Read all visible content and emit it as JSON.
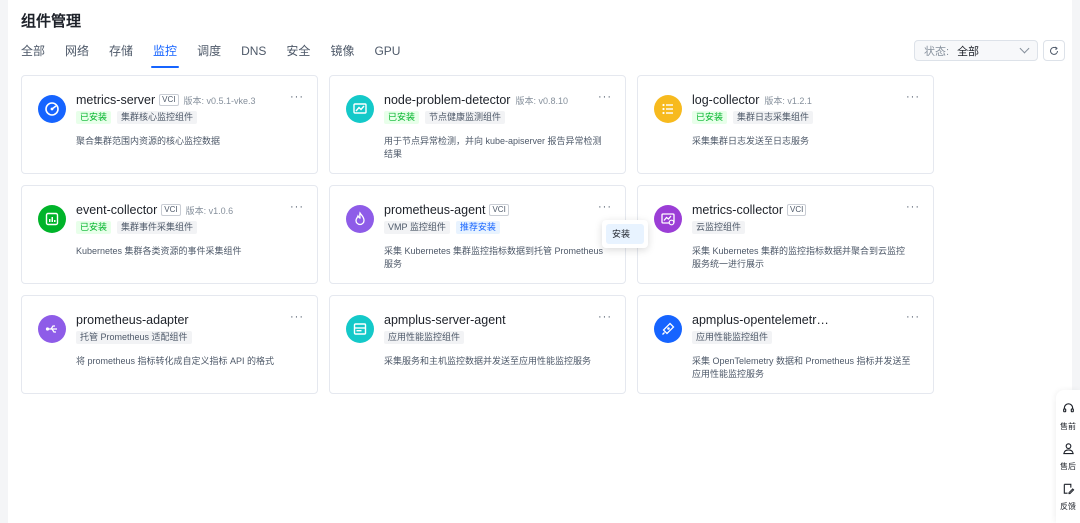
{
  "page_title": "组件管理",
  "tabs": [
    {
      "label": "全部",
      "active": false
    },
    {
      "label": "网络",
      "active": false
    },
    {
      "label": "存储",
      "active": false
    },
    {
      "label": "监控",
      "active": true
    },
    {
      "label": "调度",
      "active": false
    },
    {
      "label": "DNS",
      "active": false
    },
    {
      "label": "安全",
      "active": false
    },
    {
      "label": "镜像",
      "active": false
    },
    {
      "label": "GPU",
      "active": false
    }
  ],
  "filter": {
    "label": "状态:",
    "value": "全部"
  },
  "colors": {
    "accent": "#1664ff",
    "installed": "#00b42a"
  },
  "cards": [
    {
      "name": "metrics-server",
      "vci": "VCI",
      "version": "版本: v0.5.1-vke.3",
      "tags": [
        {
          "text": "已安装",
          "style": "green"
        },
        {
          "text": "集群核心监控组件",
          "style": "gray"
        }
      ],
      "desc": "聚合集群范围内资源的核心监控数据",
      "icon": "metrics-server-icon",
      "icon_color": "#1664ff"
    },
    {
      "name": "node-problem-detector",
      "vci": "",
      "version": "版本: v0.8.10",
      "tags": [
        {
          "text": "已安装",
          "style": "green"
        },
        {
          "text": "节点健康监测组件",
          "style": "gray"
        }
      ],
      "desc": "用于节点异常检测，并向 kube-apiserver 报告异常检测结果",
      "icon": "node-problem-detector-icon",
      "icon_color": "#14c9c9"
    },
    {
      "name": "log-collector",
      "vci": "",
      "version": "版本: v1.2.1",
      "tags": [
        {
          "text": "已安装",
          "style": "green"
        },
        {
          "text": "集群日志采集组件",
          "style": "gray"
        }
      ],
      "desc": "采集集群日志发送至日志服务",
      "icon": "log-collector-icon",
      "icon_color": "#f7ba1e"
    },
    {
      "name": "event-collector",
      "vci": "VCI",
      "version": "版本: v1.0.6",
      "tags": [
        {
          "text": "已安装",
          "style": "green"
        },
        {
          "text": "集群事件采集组件",
          "style": "gray"
        }
      ],
      "desc": "Kubernetes 集群各类资源的事件采集组件",
      "icon": "event-collector-icon",
      "icon_color": "#00b42a"
    },
    {
      "name": "prometheus-agent",
      "vci": "VCI",
      "version": "",
      "tags": [
        {
          "text": "VMP 监控组件",
          "style": "gray"
        },
        {
          "text": "推荐安装",
          "style": "blue"
        }
      ],
      "desc": "采集 Kubernetes 集群监控指标数据到托管 Prometheus 服务",
      "icon": "prometheus-agent-icon",
      "icon_color": "#8e5ce8"
    },
    {
      "name": "metrics-collector",
      "vci": "VCI",
      "version": "",
      "tags": [
        {
          "text": "云监控组件",
          "style": "gray"
        }
      ],
      "desc": "采集 Kubernetes 集群的监控指标数据并聚合到云监控服务统一进行展示",
      "icon": "metrics-collector-icon",
      "icon_color": "#9b3ed6"
    },
    {
      "name": "prometheus-adapter",
      "vci": "",
      "version": "",
      "tags": [
        {
          "text": "托管 Prometheus 适配组件",
          "style": "gray"
        }
      ],
      "desc": "将 prometheus 指标转化成自定义指标 API 的格式",
      "icon": "prometheus-adapter-icon",
      "icon_color": "#8e5ce8"
    },
    {
      "name": "apmplus-server-agent",
      "vci": "",
      "version": "",
      "tags": [
        {
          "text": "应用性能监控组件",
          "style": "gray"
        }
      ],
      "desc": "采集服务和主机监控数据并发送至应用性能监控服务",
      "icon": "apmplus-server-agent-icon",
      "icon_color": "#14c9c9"
    },
    {
      "name": "apmplus-opentelemetr…",
      "vci": "",
      "version": "",
      "tags": [
        {
          "text": "应用性能监控组件",
          "style": "gray"
        }
      ],
      "desc": "采集 OpenTelemetry 数据和 Prometheus 指标并发送至应用性能监控服务",
      "icon": "apmplus-opentelemetry-icon",
      "icon_color": "#1664ff"
    }
  ],
  "more_label": "···",
  "dropdown_menu": {
    "item": "安装"
  },
  "side_toolbar": [
    {
      "label": "售前",
      "icon": "headset-icon"
    },
    {
      "label": "售后",
      "icon": "support-agent-icon"
    },
    {
      "label": "反馈",
      "icon": "feedback-icon"
    }
  ]
}
